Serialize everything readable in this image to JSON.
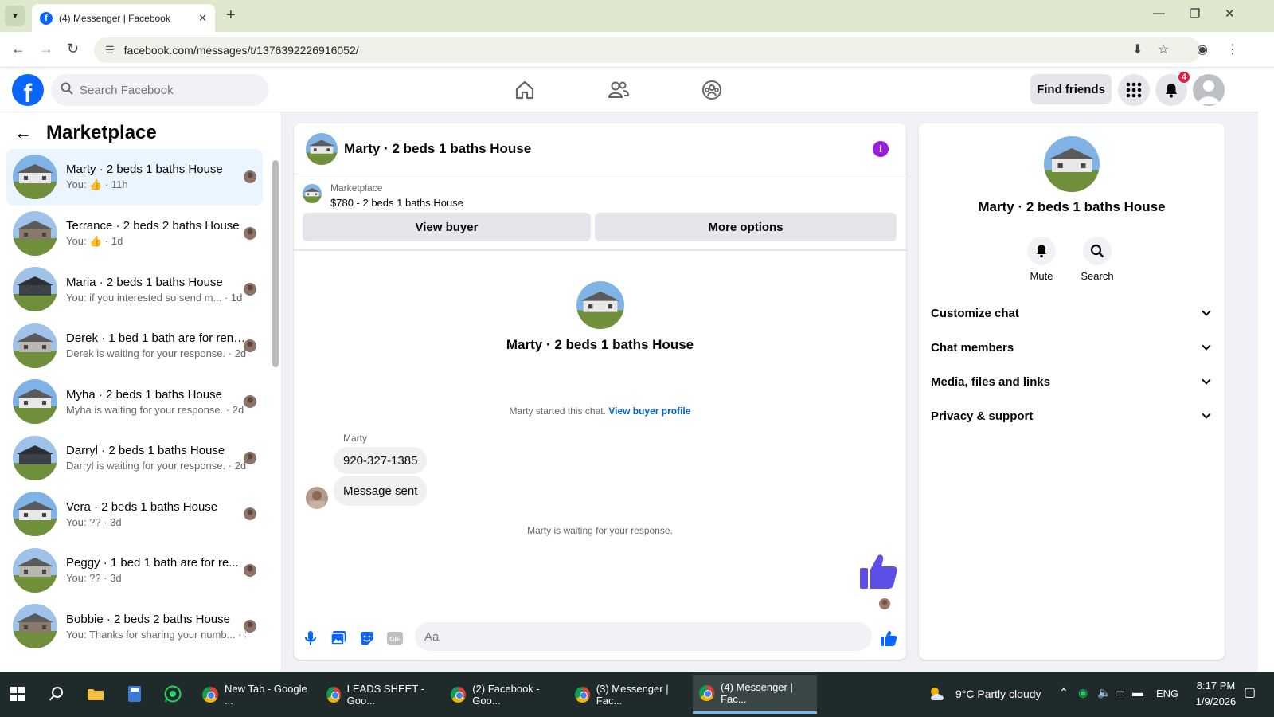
{
  "browser": {
    "tab_title": "(4) Messenger | Facebook",
    "url": "facebook.com/messages/t/1376392226916052/"
  },
  "facebook": {
    "search_placeholder": "Search Facebook",
    "find_friends": "Find friends",
    "notification_count": "4"
  },
  "left_panel": {
    "title": "Marketplace",
    "chats": [
      {
        "name": "Marty · 2 beds 1 baths House",
        "snippet": "You: 👍 · 11h",
        "active": true,
        "thumb": "field"
      },
      {
        "name": "Terrance · 2 beds 2 baths House",
        "snippet": "You: 👍 · 1d",
        "active": false,
        "thumb": "brick"
      },
      {
        "name": "Maria · 2 beds 1 baths House",
        "snippet": "You: if you interested so send m... · 1d",
        "active": false,
        "thumb": "dark"
      },
      {
        "name": "Derek · 1 bed 1 bath are for rent ...",
        "snippet": "Derek is waiting for your response. · 2d",
        "active": false,
        "thumb": "grey"
      },
      {
        "name": "Myha · 2 beds 1 baths House",
        "snippet": "Myha is waiting for your response. · 2d",
        "active": false,
        "thumb": "field"
      },
      {
        "name": "Darryl · 2 beds 1 baths House",
        "snippet": "Darryl is waiting for your response. · 2d",
        "active": false,
        "thumb": "dark"
      },
      {
        "name": "Vera · 2 beds 1 baths House",
        "snippet": "You: ?? · 3d",
        "active": false,
        "thumb": "field"
      },
      {
        "name": "Peggy · 1 bed 1 bath are for re...",
        "snippet": "You: ?? · 3d",
        "active": false,
        "thumb": "grey"
      },
      {
        "name": "Bobbie · 2 beds 2 baths House",
        "snippet": "You: Thanks for sharing your numb... · 3d",
        "active": false,
        "thumb": "brick"
      }
    ]
  },
  "conversation": {
    "title": "Marty · 2 beds 1 baths House",
    "marketplace_label": "Marketplace",
    "listing": "$780 - 2 beds 1 baths House",
    "view_buyer": "View buyer",
    "more_options": "More options",
    "profile_name": "Marty · 2 beds 1 baths House",
    "started_text": "Marty started this chat.",
    "view_buyer_profile": "View buyer profile",
    "sender_name": "Marty",
    "messages": [
      "920-327-1385",
      "Message sent"
    ],
    "waiting_text": "Marty is waiting for your response.",
    "composer_placeholder": "Aa"
  },
  "info_panel": {
    "name": "Marty · 2 beds 1 baths House",
    "mute": "Mute",
    "search": "Search",
    "sections": [
      "Customize chat",
      "Chat members",
      "Media, files and links",
      "Privacy & support"
    ]
  },
  "taskbar": {
    "apps": [
      "New Tab - Google ...",
      "LEADS SHEET - Goo...",
      "(2) Facebook - Goo...",
      "(3) Messenger | Fac...",
      "(4) Messenger | Fac..."
    ],
    "weather": "9°C  Partly cloudy",
    "language": "ENG",
    "time": "8:17 PM",
    "date": "1/9/2026"
  },
  "colors": {
    "fb_blue": "#0866ff",
    "messenger_purple": "#9a1ce0",
    "thumb_blue": "#5b4fe8"
  }
}
